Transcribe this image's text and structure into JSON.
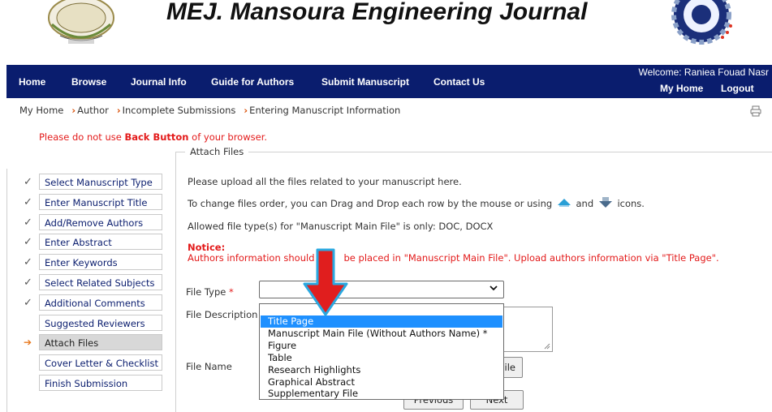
{
  "header": {
    "journal_title": "MEJ. Mansoura Engineering Journal"
  },
  "nav": {
    "items": [
      "Home",
      "Browse",
      "Journal Info",
      "Guide for Authors",
      "Submit Manuscript",
      "Contact Us"
    ],
    "welcome": "Welcome: Raniea Fouad Nasr",
    "my_home": "My Home",
    "logout": "Logout"
  },
  "breadcrumb": [
    "My Home",
    "Author",
    "Incomplete Submissions",
    "Entering Manuscript Information"
  ],
  "warning": {
    "prefix": "Please do not use ",
    "bold": "Back Button",
    "suffix": " of your browser."
  },
  "steps": [
    {
      "label": "Select Manuscript Type",
      "mark": "✓"
    },
    {
      "label": "Enter Manuscript Title",
      "mark": "✓"
    },
    {
      "label": "Add/Remove Authors",
      "mark": "✓"
    },
    {
      "label": "Enter Abstract",
      "mark": "✓"
    },
    {
      "label": "Enter Keywords",
      "mark": "✓"
    },
    {
      "label": "Select Related Subjects",
      "mark": "✓"
    },
    {
      "label": "Additional Comments",
      "mark": "✓"
    },
    {
      "label": "Suggested Reviewers",
      "mark": ""
    },
    {
      "label": "Attach Files",
      "mark": "➔"
    },
    {
      "label": "Cover Letter & Checklist",
      "mark": ""
    },
    {
      "label": "Finish Submission",
      "mark": ""
    }
  ],
  "attach": {
    "legend": "Attach Files",
    "intro": "Please upload all the files related to your manuscript here.",
    "order_prefix": "To change files order, you can Drag and Drop each row by the mouse or using",
    "order_and": "and",
    "order_suffix": "icons.",
    "allowed": "Allowed file type(s) for \"Manuscript Main File\" is only: DOC, DOCX",
    "notice_title": "Notice:",
    "notice_part1": "Authors information should",
    "notice_part2": "be placed in \"Manuscript Main File\". Upload authors information via \"Title Page\".",
    "file_type_label": "File Type",
    "required_mark": "*",
    "file_description_label": "File Description",
    "file_name_label": "File Name",
    "browse_button_partial": "ile",
    "previous_button": "Previous",
    "next_button": "Next"
  },
  "file_type_options": [
    "Title Page",
    "Manuscript Main File (Without Authors Name) *",
    "Figure",
    "Table",
    "Research Highlights",
    "Graphical Abstract",
    "Supplementary File"
  ],
  "highlighted_option": "Title Page",
  "colors": {
    "navbar": "#0a1d6e",
    "warning_red": "#e31a1a",
    "highlight": "#1e90ff",
    "arrow_red": "#e01e1e",
    "arrow_outline": "#2aa8e0"
  },
  "icons": {
    "print": "printer-icon",
    "up": "up-arrow-icon",
    "down": "down-arrow-icon"
  }
}
